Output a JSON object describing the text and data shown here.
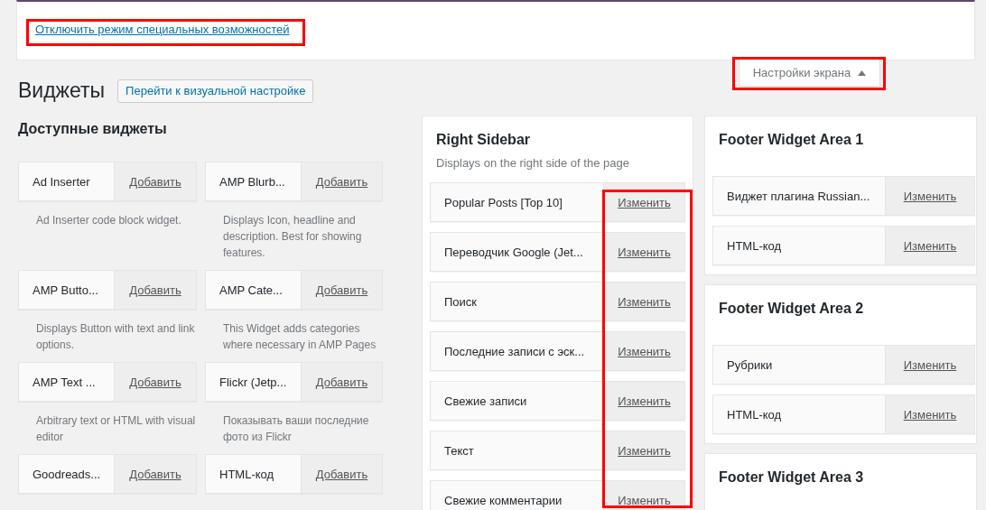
{
  "notice": {
    "link": "Отключить режим специальных возможностей",
    "highlighted": true
  },
  "screen_options": {
    "label": "Настройки экрана",
    "highlighted": true
  },
  "header": {
    "title": "Виджеты",
    "button": "Перейти к визуальной настройке"
  },
  "available": {
    "title": "Доступные виджеты",
    "widgets": [
      {
        "name": "Ad Inserter",
        "action": "Добавить",
        "description": "Ad Inserter code block widget."
      },
      {
        "name": "AMP Blurb...",
        "action": "Добавить",
        "description": "Displays Icon, headline and description. Best for showing features."
      },
      {
        "name": "AMP Butto...",
        "action": "Добавить",
        "description": "Displays Button with text and link options."
      },
      {
        "name": "AMP Cate...",
        "action": "Добавить",
        "description": "This Widget adds categories where necessary in AMP Pages"
      },
      {
        "name": "AMP Text ...",
        "action": "Добавить",
        "description": "Arbitrary text or HTML with visual editor"
      },
      {
        "name": "Flickr (Jetp...",
        "action": "Добавить",
        "description": "Показывать ваши последние фото из Flickr"
      },
      {
        "name": "Goodreads...",
        "action": "Добавить"
      },
      {
        "name": "HTML-код",
        "action": "Добавить"
      }
    ]
  },
  "right_sidebar": {
    "title": "Right Sidebar",
    "description": "Displays on the right side of the page",
    "edit_column_highlighted": true,
    "widgets": [
      {
        "name": "Popular Posts [Top 10]",
        "action": "Изменить"
      },
      {
        "name": "Переводчик Google (Jet...",
        "action": "Изменить"
      },
      {
        "name": "Поиск",
        "action": "Изменить"
      },
      {
        "name": "Последние записи с эск...",
        "action": "Изменить"
      },
      {
        "name": "Свежие записи",
        "action": "Изменить"
      },
      {
        "name": "Текст",
        "action": "Изменить"
      },
      {
        "name": "Свежие комментарии",
        "action": "Изменить"
      }
    ]
  },
  "footer_areas": [
    {
      "title": "Footer Widget Area 1",
      "widgets": [
        {
          "name": "Виджет плагина Russian...",
          "action": "Изменить"
        },
        {
          "name": "HTML-код",
          "action": "Изменить"
        }
      ]
    },
    {
      "title": "Footer Widget Area 2",
      "widgets": [
        {
          "name": "Рубрики",
          "action": "Изменить"
        },
        {
          "name": "HTML-код",
          "action": "Изменить"
        }
      ]
    },
    {
      "title": "Footer Widget Area 3"
    }
  ]
}
